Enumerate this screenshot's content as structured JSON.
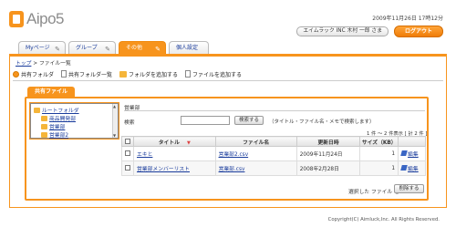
{
  "header": {
    "logo_text": "Aipo5",
    "datetime": "2009年11月26日 17時12分",
    "user": "エイムラック INC 木村 一郎 さま",
    "logout_label": "ログアウト"
  },
  "tabs": [
    {
      "label": "Myページ",
      "active": false
    },
    {
      "label": "グループ",
      "active": false
    },
    {
      "label": "その他",
      "active": true
    },
    {
      "label": "個人設定",
      "active": false
    }
  ],
  "breadcrumb": {
    "top": "トップ",
    "separator": " > ",
    "current": "ファイル一覧"
  },
  "toolbar": {
    "shared_folder": "共有フォルダ",
    "shared_folder_list": "共有フォルダ一覧",
    "add_folder": "フォルダを追加する",
    "add_file": "ファイルを追加する"
  },
  "inner_tab": "共有ファイル",
  "tree": {
    "root": "ルートフォルダ",
    "items": [
      "商品開発部",
      "営業部",
      "営業部2"
    ]
  },
  "panel": {
    "title": "営業部",
    "search_label": "検索",
    "search_value": "",
    "search_button": "検索する",
    "search_hint": "（タイトル・ファイル名・メモで検索します）",
    "count": "1 件 〜 2 件表示 [ 計 2 件 ]"
  },
  "table": {
    "headers": [
      "タイトル",
      "ファイル名",
      "更新日時",
      "サイズ（KB）"
    ],
    "sort_marker": "▼",
    "edit_label": "編集",
    "rows": [
      {
        "title": "エキと",
        "filename": "営業部2.csv",
        "updated": "2009年11月24日",
        "size": "1"
      },
      {
        "title": "営業部メンバーリスト",
        "filename": "営業部.csv",
        "updated": "2008年2月28日",
        "size": "1"
      }
    ]
  },
  "footer_actions": {
    "selected_label": "選択した ファイル を",
    "delete_button": "削除する"
  },
  "copyright": "Copyright(C) Aimluck,Inc. All Rights Reserved.",
  "colors": {
    "accent": "#f7941d",
    "link": "#1a3c9c"
  }
}
